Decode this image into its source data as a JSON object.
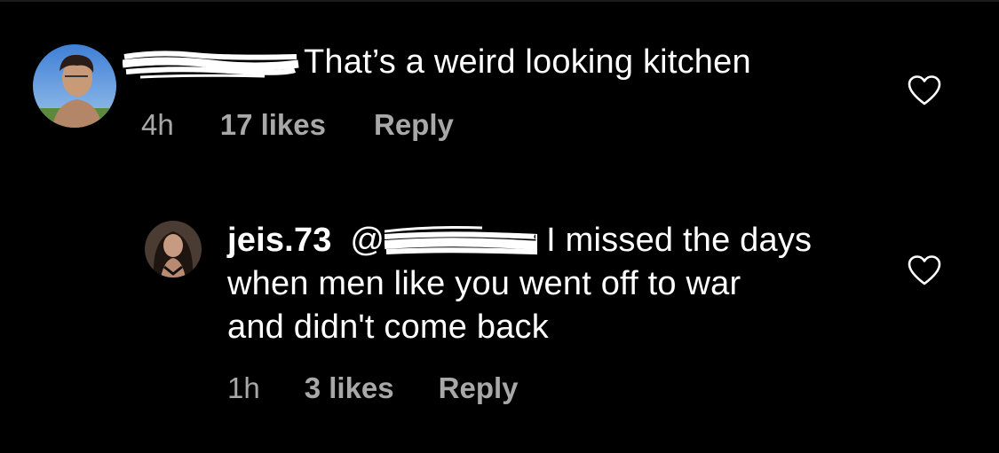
{
  "comments": [
    {
      "username_redacted": true,
      "text": "That’s a weird looking kitchen",
      "time": "4h",
      "likes": "17 likes",
      "reply_label": "Reply",
      "avatar_icon": "profile-photo-man",
      "like_icon": "heart-outline-icon"
    },
    {
      "username": "jeis.73",
      "mention_prefix": "@",
      "mention_redacted": true,
      "text_line1": "I missed the days",
      "text_line2": "when men like you went off to war",
      "text_line3": "and didn't come back",
      "time": "1h",
      "likes": "3 likes",
      "reply_label": "Reply",
      "avatar_icon": "profile-photo-woman",
      "like_icon": "heart-outline-icon"
    }
  ],
  "colors": {
    "background": "#000000",
    "text": "#ffffff",
    "meta": "#a8a8a8"
  }
}
